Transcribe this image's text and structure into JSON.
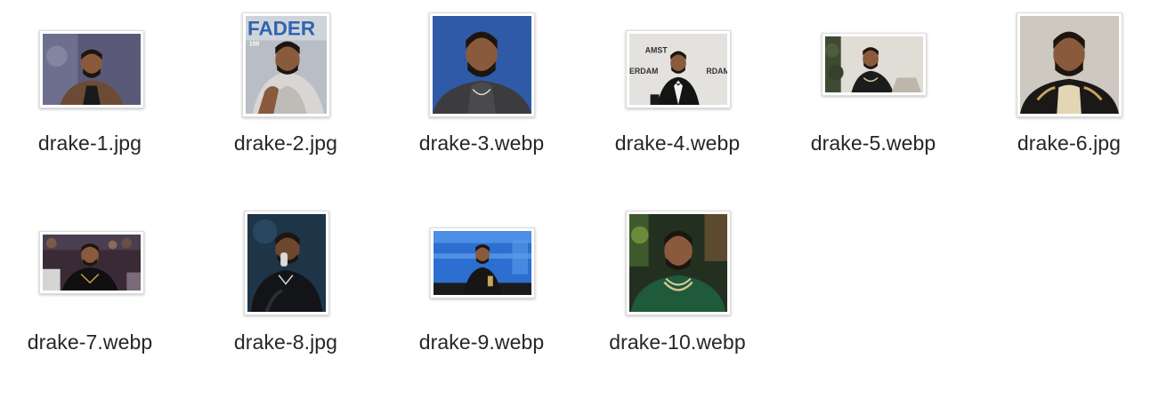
{
  "files": [
    {
      "name": "drake-1.jpg",
      "thumbnail_icon": "portrait-photo-icon"
    },
    {
      "name": "drake-2.jpg",
      "thumbnail_icon": "magazine-cover-photo-icon",
      "cover_text": "FADER",
      "cover_number": "100"
    },
    {
      "name": "drake-3.webp",
      "thumbnail_icon": "portrait-photo-icon"
    },
    {
      "name": "drake-4.webp",
      "thumbnail_icon": "red-carpet-photo-icon",
      "backdrop_text_left": "AMST",
      "backdrop_text_mid": "ERDAM",
      "backdrop_text_right": "RDAM"
    },
    {
      "name": "drake-5.webp",
      "thumbnail_icon": "portrait-photo-icon"
    },
    {
      "name": "drake-6.jpg",
      "thumbnail_icon": "portrait-photo-icon"
    },
    {
      "name": "drake-7.webp",
      "thumbnail_icon": "courtside-photo-icon"
    },
    {
      "name": "drake-8.jpg",
      "thumbnail_icon": "concert-photo-icon"
    },
    {
      "name": "drake-9.webp",
      "thumbnail_icon": "award-stage-photo-icon"
    },
    {
      "name": "drake-10.webp",
      "thumbnail_icon": "portrait-photo-icon"
    }
  ]
}
